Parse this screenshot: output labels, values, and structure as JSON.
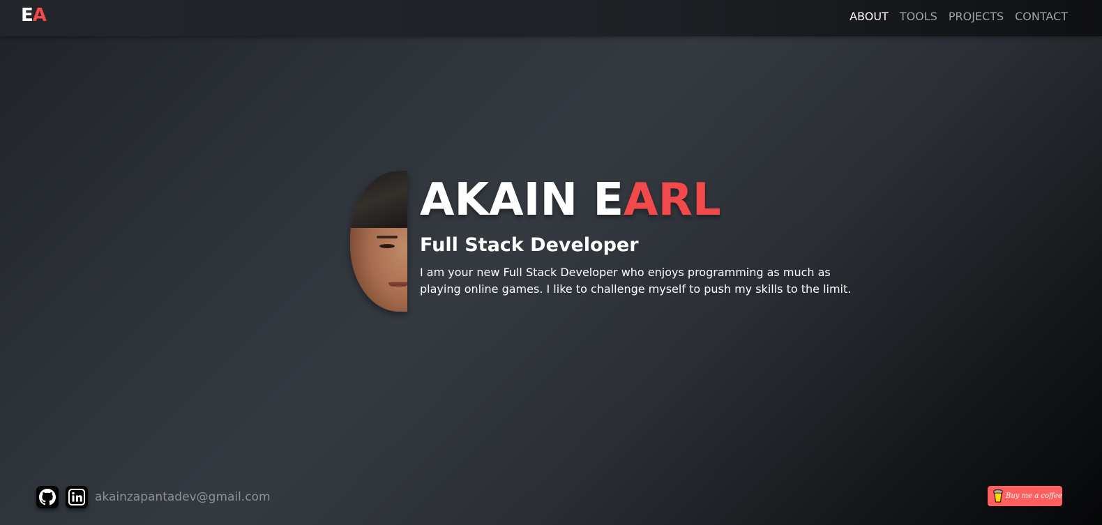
{
  "nav": {
    "logo_first": "E",
    "logo_second": "A",
    "links": [
      "ABOUT",
      "TOOLS",
      "PROJECTS",
      "CONTACT"
    ],
    "active": "ABOUT"
  },
  "hero": {
    "name_white": "AKAIN E",
    "name_red": "ARL",
    "role": "Full Stack Developer",
    "bio": "I am your new Full Stack Developer who enjoys programming as much as playing online games. I like to challenge myself to push my skills to the limit."
  },
  "footer": {
    "github_icon": "github-icon",
    "linkedin_icon": "linkedin-icon",
    "email": "akainzapantadev@gmail.com",
    "coffee_label": "Buy me a coffee",
    "coffee_icon": "coffee-cup-icon"
  },
  "colors": {
    "accent": "#f24a4a",
    "coffee_button": "#ff5f5f",
    "nav_inactive": "#9fa3a8"
  }
}
